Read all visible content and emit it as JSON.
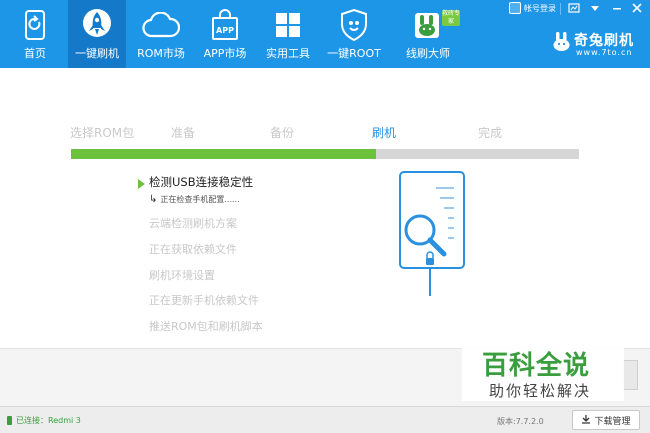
{
  "nav": {
    "items": [
      {
        "label": "首页",
        "icon": "refresh-phone-icon"
      },
      {
        "label": "一键刷机",
        "icon": "rocket-icon"
      },
      {
        "label": "ROM市场",
        "icon": "cloud-icon"
      },
      {
        "label": "APP市场",
        "icon": "app-bag-icon"
      },
      {
        "label": "实用工具",
        "icon": "grid-icon"
      },
      {
        "label": "一键ROOT",
        "icon": "shield-icon"
      },
      {
        "label": "线刷大师",
        "icon": "bunny-icon"
      }
    ],
    "active_index": 1,
    "badge": "救砖专家"
  },
  "window": {
    "login_label": "帐号登录",
    "brand_name": "奇兔刷机",
    "brand_url": "www.7to.cn"
  },
  "steps": {
    "items": [
      "选择ROM包",
      "准备",
      "备份",
      "刷机",
      "完成"
    ],
    "current_index": 3,
    "progress": 0.6
  },
  "tasks": {
    "items": [
      "检测USB连接稳定性",
      "云端检测刷机方案",
      "正在获取依赖文件",
      "刷机环境设置",
      "正在更新手机依赖文件",
      "推送ROM包和刷机脚本"
    ],
    "active_index": 0,
    "sub_status": "正在检查手机配置......"
  },
  "watermark": {
    "title": "百科全说",
    "subtitle": "助你轻松解决"
  },
  "status": {
    "connection": "已连接：Redmi 3",
    "version": "版本:7.7.2.0",
    "download_label": "下载管理"
  },
  "colors": {
    "topbar": "#1e96e8",
    "progress": "#6cc23c",
    "current_step": "#2a91e0"
  }
}
